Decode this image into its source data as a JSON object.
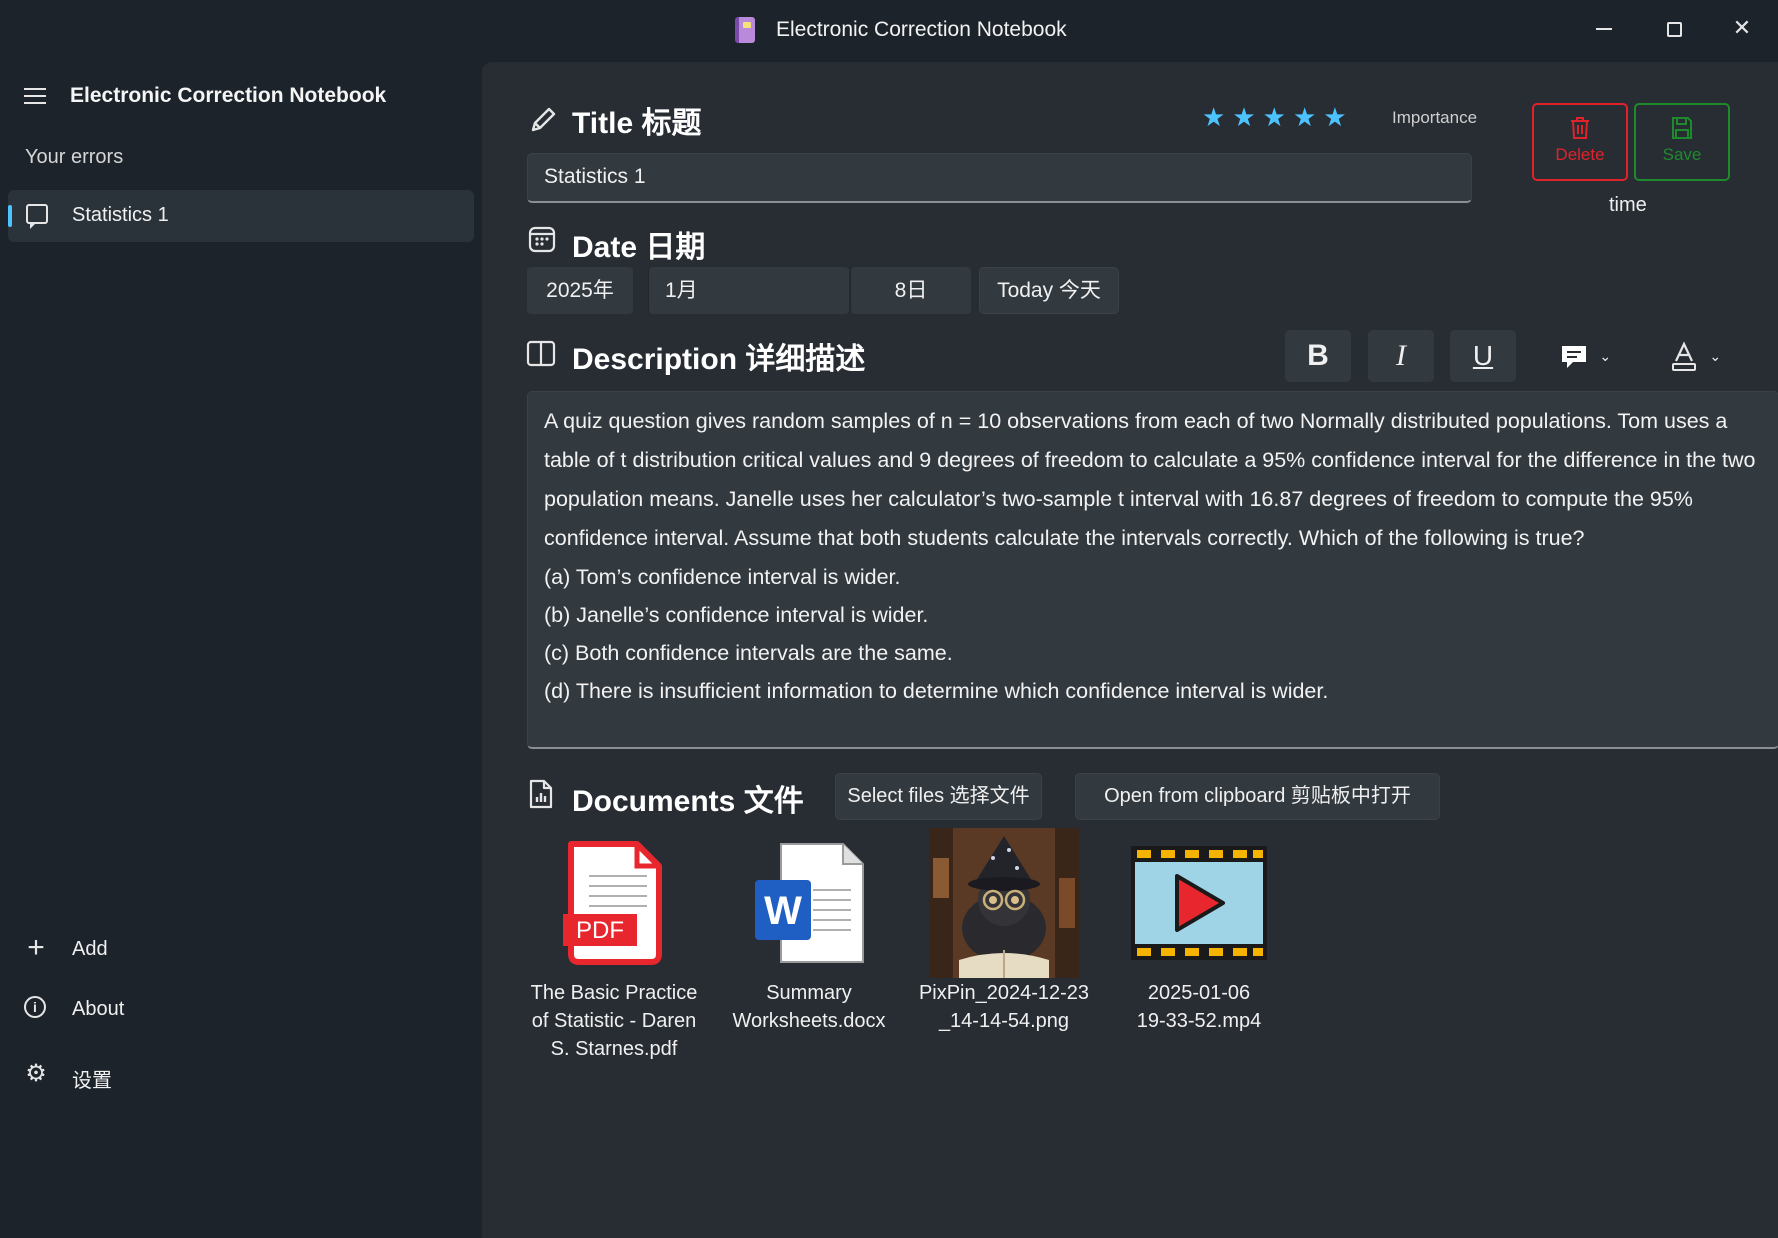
{
  "window": {
    "title": "Electronic Correction Notebook"
  },
  "sidebar": {
    "app_name": "Electronic Correction Notebook",
    "section_label": "Your errors",
    "items": [
      {
        "label": "Statistics 1",
        "selected": true
      }
    ],
    "footer": [
      {
        "label": "Add",
        "icon": "plus-icon"
      },
      {
        "label": "About",
        "icon": "info-icon"
      },
      {
        "label": "设置",
        "icon": "gear-icon"
      }
    ]
  },
  "editor": {
    "title_heading": "Title 标题",
    "title_value": "Statistics 1",
    "importance_label": "Importance",
    "importance_value": 5,
    "importance_max": 5,
    "delete_label": "Delete",
    "save_label": "Save",
    "time_label": "time",
    "date_heading": "Date 日期",
    "date_year": "2025年",
    "date_month": "1月",
    "date_day": "8日",
    "today_label": "Today 今天",
    "description_heading": "Description 详细描述",
    "description_lines": [
      "A quiz question gives random samples of n = 10 observations from each of two Normally distributed populations. Tom uses a table of t distribution critical values and 9 degrees of freedom to calculate a 95% confidence interval for the difference in the two population means. Janelle uses her calculator’s two-sample t interval with 16.87 degrees of freedom to compute the 95% confidence interval. Assume that both students calculate the intervals correctly. Which of the following is true?",
      "(a) Tom’s confidence interval is wider.",
      "(b) Janelle’s confidence interval is wider.",
      "(c) Both confidence intervals are the same.",
      "(d) There is insufficient information to determine which confidence interval is wider."
    ],
    "documents_heading": "Documents 文件",
    "select_files_label": "Select files 选择文件",
    "clipboard_label": "Open from clipboard 剪贴板中打开",
    "files": [
      {
        "name_line1": "The Basic Practice",
        "name_line2": "of Statistic - Daren",
        "name_line3": "S. Starnes.pdf",
        "icon": "pdf-file-icon"
      },
      {
        "name_line1": "Summary",
        "name_line2": "Worksheets.docx",
        "name_line3": "",
        "icon": "word-file-icon"
      },
      {
        "name_line1": "PixPin_2024-12-23",
        "name_line2": "_14-14-54.png",
        "name_line3": "",
        "icon": "image-thumbnail"
      },
      {
        "name_line1": "2025-01-06",
        "name_line2": "19-33-52.mp4",
        "name_line3": "",
        "icon": "video-file-icon"
      }
    ]
  },
  "colors": {
    "accent": "#4cc2ff",
    "delete": "#e0222a",
    "save": "#1e8a2e",
    "background": "#1c232b",
    "panel": "#272d33"
  }
}
